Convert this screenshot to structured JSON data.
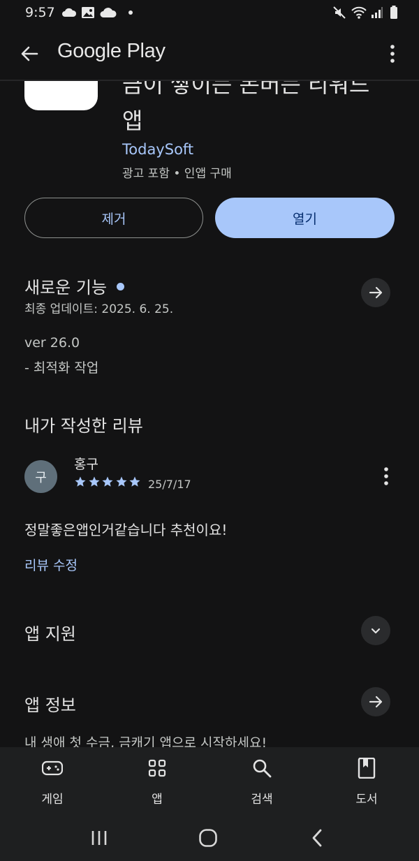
{
  "status_bar": {
    "time": "9:57"
  },
  "header": {
    "title": "Google Play"
  },
  "app": {
    "title_line1": "금이 쌓이는 돈버는 리워드",
    "title_line2": "앱",
    "developer": "TodaySoft",
    "meta": "광고 포함 • 인앱 구매",
    "uninstall_label": "제거",
    "open_label": "열기"
  },
  "whats_new": {
    "title": "새로운 기능",
    "updated": "최종 업데이트: 2025. 6. 25.",
    "notes": [
      "ver 26.0",
      "- 최적화 작업"
    ]
  },
  "my_review": {
    "title": "내가 작성한 리뷰",
    "avatar_initial": "구",
    "author": "홍구",
    "rating": 5,
    "date": "25/7/17",
    "text": "정말좋은앱인거같습니다 추천이요!",
    "edit_label": "리뷰 수정"
  },
  "app_support": {
    "title": "앱 지원"
  },
  "about": {
    "title": "앱 정보",
    "text": "내 생애 첫 수금, 금캐기 앱으로 시작하세요!"
  },
  "bottom_nav": {
    "items": [
      {
        "label": "게임",
        "icon": "gamepad-icon"
      },
      {
        "label": "앱",
        "icon": "apps-grid-icon"
      },
      {
        "label": "검색",
        "icon": "search-icon"
      },
      {
        "label": "도서",
        "icon": "book-icon"
      }
    ]
  },
  "colors": {
    "background": "#131314",
    "accent": "#a8c7fa",
    "open_button_text": "#062e6f"
  }
}
